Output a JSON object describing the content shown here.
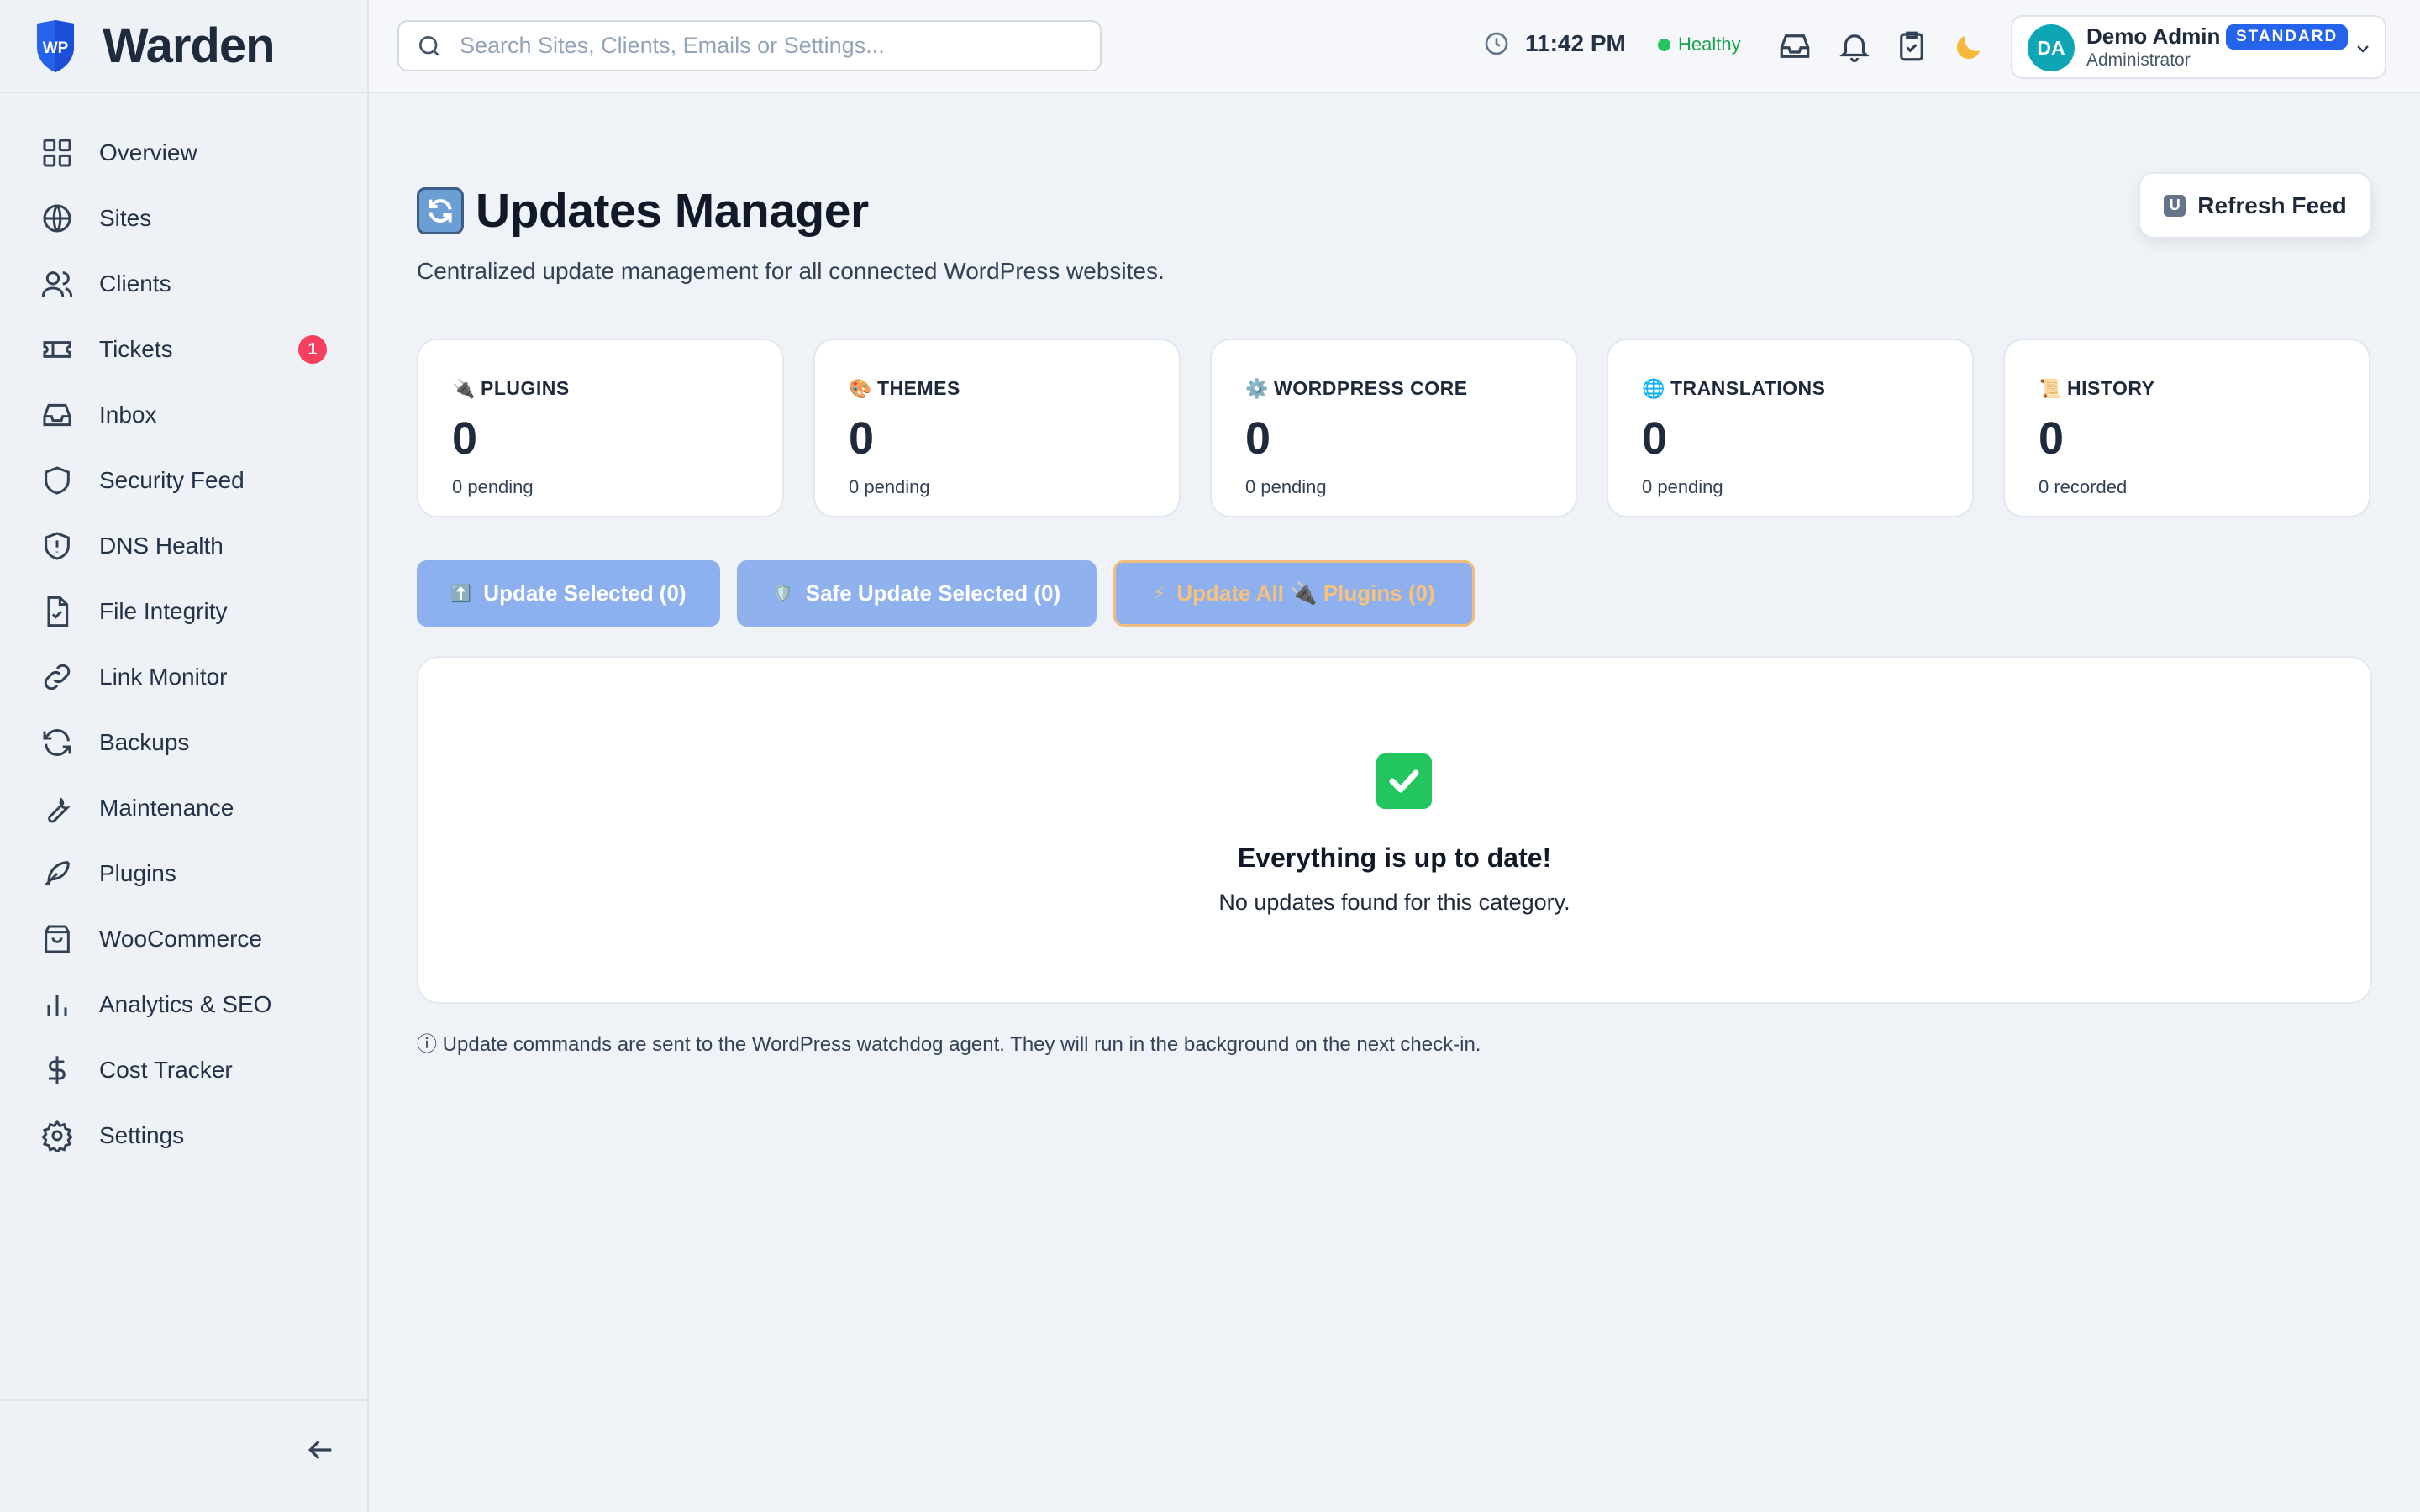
{
  "brand": {
    "name": "Warden",
    "logo_text": "WP"
  },
  "sidebar": {
    "items": [
      {
        "label": "Overview",
        "icon": "grid-icon"
      },
      {
        "label": "Sites",
        "icon": "globe-icon"
      },
      {
        "label": "Clients",
        "icon": "users-icon"
      },
      {
        "label": "Tickets",
        "icon": "ticket-icon",
        "badge": "1"
      },
      {
        "label": "Inbox",
        "icon": "inbox-icon"
      },
      {
        "label": "Security Feed",
        "icon": "shield-icon"
      },
      {
        "label": "DNS Health",
        "icon": "shield-alert-icon"
      },
      {
        "label": "File Integrity",
        "icon": "file-check-icon"
      },
      {
        "label": "Link Monitor",
        "icon": "link-icon"
      },
      {
        "label": "Backups",
        "icon": "refresh-icon"
      },
      {
        "label": "Maintenance",
        "icon": "wrench-icon"
      },
      {
        "label": "Plugins",
        "icon": "feather-icon"
      },
      {
        "label": "WooCommerce",
        "icon": "shopping-bag-icon"
      },
      {
        "label": "Analytics & SEO",
        "icon": "bar-chart-icon"
      },
      {
        "label": "Cost Tracker",
        "icon": "dollar-icon"
      },
      {
        "label": "Settings",
        "icon": "gear-icon"
      }
    ]
  },
  "topbar": {
    "search_placeholder": "Search Sites, Clients, Emails or Settings...",
    "time": "11:42 PM",
    "health": "Healthy",
    "user": {
      "initials": "DA",
      "name": "Demo Admin",
      "role": "Administrator",
      "plan": "STANDARD"
    }
  },
  "page": {
    "title": "Updates Manager",
    "subtitle": "Centralized update management for all connected WordPress websites.",
    "refresh_label": "Refresh Feed",
    "refresh_icon_text": "U"
  },
  "cards": [
    {
      "emoji": "🔌",
      "label": "PLUGINS",
      "count": "0",
      "sub": "0 pending"
    },
    {
      "emoji": "🎨",
      "label": "THEMES",
      "count": "0",
      "sub": "0 pending"
    },
    {
      "emoji": "⚙️",
      "label": "WORDPRESS CORE",
      "count": "0",
      "sub": "0 pending"
    },
    {
      "emoji": "🌐",
      "label": "TRANSLATIONS",
      "count": "0",
      "sub": "0 pending"
    },
    {
      "emoji": "📜",
      "label": "HISTORY",
      "count": "0",
      "sub": "0 recorded"
    }
  ],
  "actions": {
    "update_selected": {
      "emoji": "⬆️",
      "label": "Update Selected (0)"
    },
    "safe_update_selected": {
      "emoji": "🛡️",
      "label": "Safe Update Selected (0)"
    },
    "update_all": {
      "emoji": "⚡",
      "label": "Update All 🔌 Plugins (0)"
    }
  },
  "empty_state": {
    "title": "Everything is up to date!",
    "message": "No updates found for this category."
  },
  "footnote": "ⓘ Update commands are sent to the WordPress watchdog agent. They will run in the background on the next check-in.",
  "colors": {
    "accent": "#2563eb",
    "badge": "#f43f5e",
    "success": "#22c55e",
    "avatar": "#0ea5b7"
  }
}
